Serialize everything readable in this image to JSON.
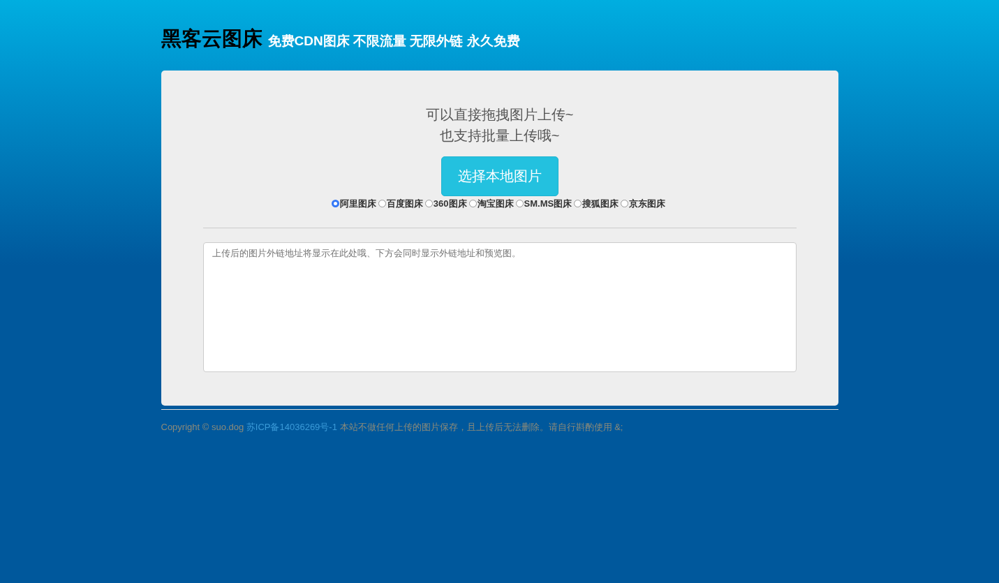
{
  "header": {
    "title": "黑客云图床",
    "subtitle": "免费CDN图床 不限流量 无限外链 永久免费"
  },
  "upload": {
    "hint_lines": [
      "可以直接拖拽图片上传~",
      "也支持批量上传哦~"
    ],
    "button": "选择本地图片",
    "hosts": [
      {
        "label": "阿里图床",
        "selected": true
      },
      {
        "label": "百度图床",
        "selected": false
      },
      {
        "label": "360图床",
        "selected": false
      },
      {
        "label": "淘宝图床",
        "selected": false
      },
      {
        "label": "SM.MS图床",
        "selected": false
      },
      {
        "label": "搜狐图床",
        "selected": false
      },
      {
        "label": "京东图床",
        "selected": false
      }
    ],
    "result": {
      "placeholder": "上传后的图片外链地址将显示在此处哦、下方会同时显示外链地址和预览图。"
    }
  },
  "footer": {
    "prefix": "Copyright © suo.dog",
    "link": "苏ICP备14036269号-1",
    "suffix": "本站不做任何上传的图片保存，且上传后无法删除。请自行斟酌使用 &;"
  }
}
